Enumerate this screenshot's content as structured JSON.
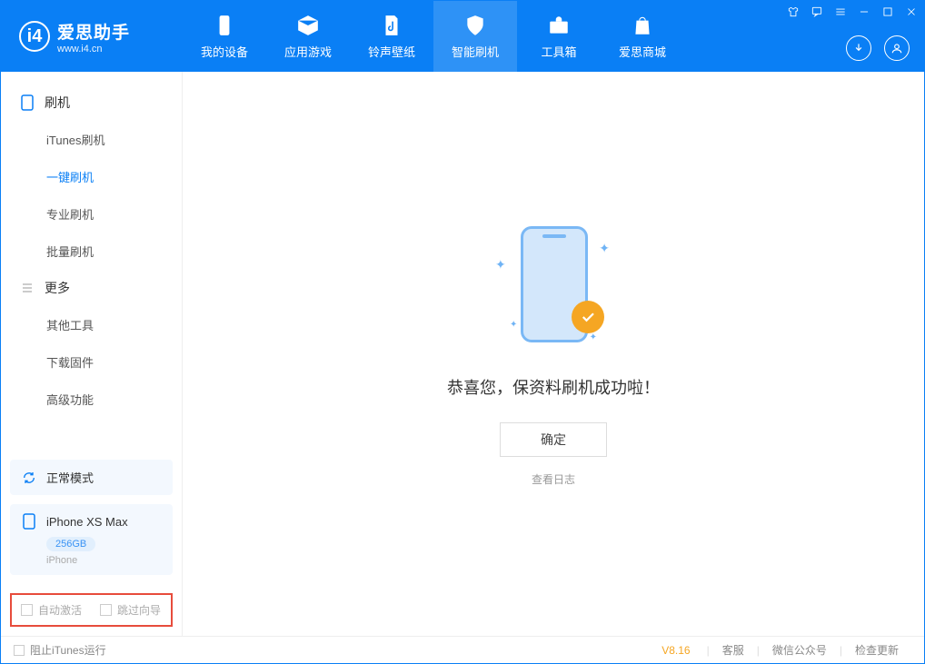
{
  "app": {
    "title": "爱思助手",
    "subtitle": "www.i4.cn"
  },
  "tabs": {
    "device": "我的设备",
    "apps": "应用游戏",
    "ring": "铃声壁纸",
    "flash": "智能刷机",
    "tools": "工具箱",
    "store": "爱思商城"
  },
  "sidebar": {
    "group1": {
      "title": "刷机",
      "items": [
        "iTunes刷机",
        "一键刷机",
        "专业刷机",
        "批量刷机"
      ]
    },
    "group2": {
      "title": "更多",
      "items": [
        "其他工具",
        "下载固件",
        "高级功能"
      ]
    },
    "mode": "正常模式",
    "device": {
      "name": "iPhone XS Max",
      "storage": "256GB",
      "type": "iPhone"
    },
    "opts": {
      "auto_activate": "自动激活",
      "skip_guide": "跳过向导"
    }
  },
  "main": {
    "message": "恭喜您，保资料刷机成功啦！",
    "ok_button": "确定",
    "log_link": "查看日志"
  },
  "footer": {
    "block_itunes": "阻止iTunes运行",
    "version": "V8.16",
    "links": [
      "客服",
      "微信公众号",
      "检查更新"
    ]
  }
}
